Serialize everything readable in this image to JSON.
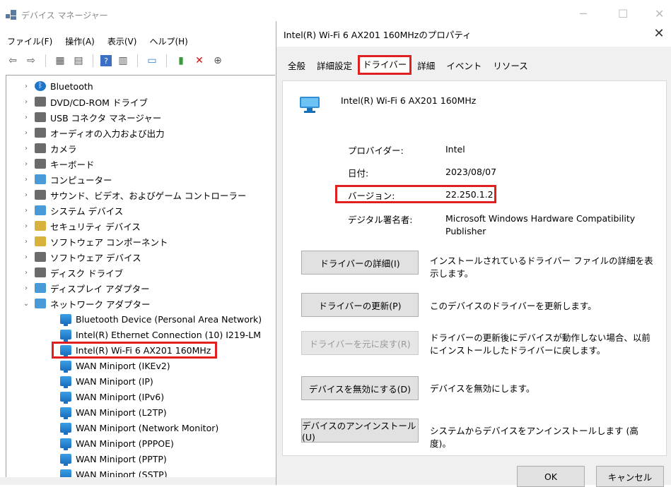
{
  "device_manager": {
    "title": "デバイス マネージャー",
    "menu": [
      "ファイル(F)",
      "操作(A)",
      "表示(V)",
      "ヘルプ(H)"
    ],
    "toolbar_icons": [
      "back-arrow-icon",
      "forward-arrow-icon",
      "view-icon",
      "properties-icon",
      "help-icon",
      "view-list-icon",
      "monitor-icon",
      "add-driver-icon",
      "remove-icon",
      "download-icon"
    ],
    "tree": [
      {
        "label": "Bluetooth",
        "icon": "bluetooth-icon",
        "expanded": false
      },
      {
        "label": "DVD/CD-ROM ドライブ",
        "icon": "dvd-drive-icon",
        "expanded": false
      },
      {
        "label": "USB コネクタ マネージャー",
        "icon": "usb-icon",
        "expanded": false
      },
      {
        "label": "オーディオの入力および出力",
        "icon": "speaker-icon",
        "expanded": false
      },
      {
        "label": "カメラ",
        "icon": "camera-icon",
        "expanded": false
      },
      {
        "label": "キーボード",
        "icon": "keyboard-icon",
        "expanded": false
      },
      {
        "label": "コンピューター",
        "icon": "computer-icon",
        "expanded": false
      },
      {
        "label": "サウンド、ビデオ、およびゲーム コントローラー",
        "icon": "sound-icon",
        "expanded": false
      },
      {
        "label": "システム デバイス",
        "icon": "system-folder-icon",
        "expanded": false
      },
      {
        "label": "セキュリティ デバイス",
        "icon": "security-icon",
        "expanded": false
      },
      {
        "label": "ソフトウェア コンポーネント",
        "icon": "software-component-icon",
        "expanded": false
      },
      {
        "label": "ソフトウェア デバイス",
        "icon": "software-device-icon",
        "expanded": false
      },
      {
        "label": "ディスク ドライブ",
        "icon": "disk-drive-icon",
        "expanded": false
      },
      {
        "label": "ディスプレイ アダプター",
        "icon": "display-adapter-icon",
        "expanded": false
      },
      {
        "label": "ネットワーク アダプター",
        "icon": "network-adapter-icon",
        "expanded": true
      }
    ],
    "network_children": [
      "Bluetooth Device (Personal Area Network)",
      "Intel(R) Ethernet Connection (10) I219-LM",
      "Intel(R) Wi-Fi 6 AX201 160MHz",
      "WAN Miniport (IKEv2)",
      "WAN Miniport (IP)",
      "WAN Miniport (IPv6)",
      "WAN Miniport (L2TP)",
      "WAN Miniport (Network Monitor)",
      "WAN Miniport (PPPOE)",
      "WAN Miniport (PPTP)",
      "WAN Miniport (SSTP)"
    ],
    "highlighted_child_index": 2
  },
  "dialog": {
    "title": "Intel(R) Wi-Fi 6 AX201 160MHzのプロパティ",
    "tabs": [
      "全般",
      "詳細設定",
      "ドライバー",
      "詳細",
      "イベント",
      "リソース"
    ],
    "active_tab": "ドライバー",
    "device_name": "Intel(R) Wi-Fi 6 AX201 160MHz",
    "info": {
      "provider_label": "プロバイダー:",
      "provider_value": "Intel",
      "date_label": "日付:",
      "date_value": "2023/08/07",
      "version_label": "バージョン:",
      "version_value": "22.250.1.2",
      "signer_label": "デジタル署名者:",
      "signer_value": "Microsoft Windows Hardware Compatibility Publisher"
    },
    "buttons": [
      {
        "label": "ドライバーの詳細(I)",
        "desc": "インストールされているドライバー ファイルの詳細を表示します。",
        "enabled": true
      },
      {
        "label": "ドライバーの更新(P)",
        "desc": "このデバイスのドライバーを更新します。",
        "enabled": true
      },
      {
        "label": "ドライバーを元に戻す(R)",
        "desc": "ドライバーの更新後にデバイスが動作しない場合、以前にインストールしたドライバーに戻します。",
        "enabled": false
      },
      {
        "label": "デバイスを無効にする(D)",
        "desc": "デバイスを無効にします。",
        "enabled": true
      },
      {
        "label": "デバイスのアンインストール(U)",
        "desc": "システムからデバイスをアンインストールします (高度)。",
        "enabled": true
      }
    ],
    "ok_label": "OK",
    "cancel_label": "キャンセル",
    "highlight_color": "#e02020"
  }
}
